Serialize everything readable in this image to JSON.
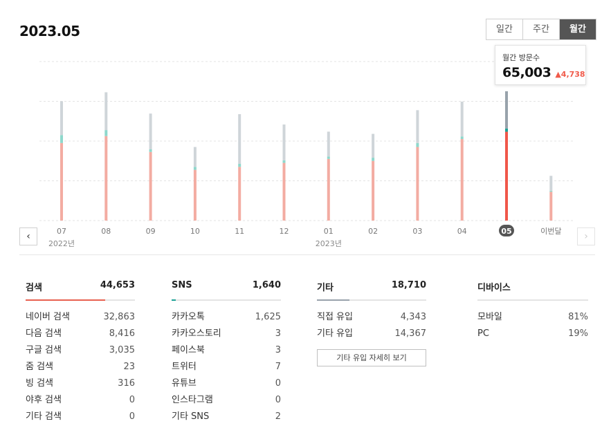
{
  "header": {
    "period": "2023.05"
  },
  "tabs": [
    {
      "label": "일간",
      "active": false
    },
    {
      "label": "주간",
      "active": false
    },
    {
      "label": "월간",
      "active": true
    }
  ],
  "tooltip": {
    "label": "월간 방문수",
    "value": "65,003",
    "delta": "▲4,738"
  },
  "colors": {
    "search": "#f3aca2",
    "search_active": "#f0574a",
    "sns": "#8ed8cc",
    "sns_active": "#1ba195",
    "etc": "#cfd5d9",
    "etc_active": "#98a2ab",
    "badge": "#555555"
  },
  "chart_data": {
    "type": "bar",
    "stacked": true,
    "categories": [
      "07",
      "08",
      "09",
      "10",
      "11",
      "12",
      "01",
      "02",
      "03",
      "04",
      "05",
      "이번달"
    ],
    "year_labels": [
      {
        "at": "07",
        "text": "2022년"
      },
      {
        "at": "01",
        "text": "2023년"
      }
    ],
    "active_category": "05",
    "series": [
      {
        "key": "search",
        "values": [
          39000,
          42500,
          34500,
          25500,
          27000,
          29000,
          31000,
          30000,
          37000,
          41000,
          44653,
          14500
        ]
      },
      {
        "key": "sns",
        "values": [
          4000,
          3000,
          1300,
          1500,
          1500,
          1300,
          1200,
          1600,
          2000,
          1300,
          1640,
          500
        ]
      },
      {
        "key": "etc",
        "values": [
          17000,
          19000,
          18000,
          10000,
          25000,
          18000,
          12500,
          12000,
          16500,
          17500,
          18710,
          7500
        ]
      }
    ],
    "ylim": [
      0,
      65003
    ],
    "grid": true
  },
  "nav": {
    "prev": "‹",
    "next": "›"
  },
  "stats": {
    "search": {
      "title": "검색",
      "total": "44,653",
      "ratio": 0.73,
      "rows": [
        {
          "label": "네이버 검색",
          "value": "32,863"
        },
        {
          "label": "다음 검색",
          "value": "8,416"
        },
        {
          "label": "구글 검색",
          "value": "3,035"
        },
        {
          "label": "줌 검색",
          "value": "23"
        },
        {
          "label": "빙 검색",
          "value": "316"
        },
        {
          "label": "야후 검색",
          "value": "0"
        },
        {
          "label": "기타 검색",
          "value": "0"
        }
      ]
    },
    "sns": {
      "title": "SNS",
      "total": "1,640",
      "ratio": 0.04,
      "rows": [
        {
          "label": "카카오톡",
          "value": "1,625"
        },
        {
          "label": "카카오스토리",
          "value": "3"
        },
        {
          "label": "페이스북",
          "value": "3"
        },
        {
          "label": "트위터",
          "value": "7"
        },
        {
          "label": "유튜브",
          "value": "0"
        },
        {
          "label": "인스타그램",
          "value": "0"
        },
        {
          "label": "기타 SNS",
          "value": "2"
        }
      ]
    },
    "etc": {
      "title": "기타",
      "total": "18,710",
      "ratio": 0.3,
      "rows": [
        {
          "label": "직접 유입",
          "value": "4,343"
        },
        {
          "label": "기타 유입",
          "value": "14,367"
        }
      ],
      "detail_button": "기타 유입 자세히 보기"
    },
    "device": {
      "title": "디바이스",
      "rows": [
        {
          "label": "모바일",
          "value": "81%"
        },
        {
          "label": "PC",
          "value": "19%"
        }
      ]
    }
  }
}
